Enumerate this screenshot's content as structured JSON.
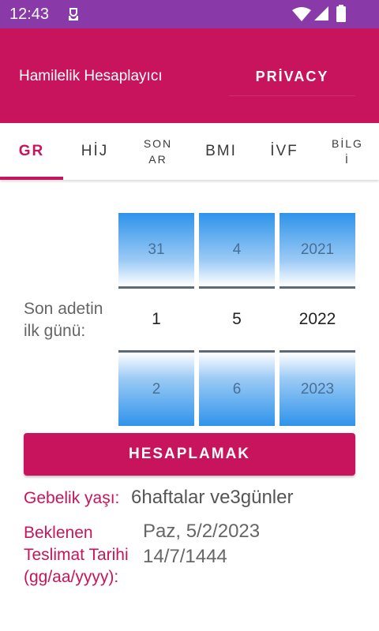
{
  "status_bar": {
    "time": "12:43"
  },
  "app_bar": {
    "title": "Hamilelik Hesaplayıcı",
    "privacy_label": "PRİVACY"
  },
  "tabs": [
    {
      "label": "GR",
      "active": true
    },
    {
      "label": "HİJ"
    },
    {
      "label_lines": [
        "SON",
        "AR"
      ]
    },
    {
      "label": "BMI"
    },
    {
      "label": "İVF"
    },
    {
      "label_lines": [
        "BİLG",
        "İ"
      ]
    }
  ],
  "form": {
    "lmp_label": "Son adetin ilk günü:",
    "pickers": {
      "day": {
        "prev": "31",
        "current": "1",
        "next": "2"
      },
      "month": {
        "prev": "4",
        "current": "5",
        "next": "6"
      },
      "year": {
        "prev": "2021",
        "current": "2022",
        "next": "2023"
      }
    },
    "calculate_label": "HESAPLAMAK"
  },
  "results": {
    "gestational_age_label": "Gebelik yaşı:",
    "gestational_age_value": "6haftalar ve3günler",
    "edd_label": "Beklenen Teslimat Tarihi (gg/aa/yyyy):",
    "edd_gregorian": "Paz, 5/2/2023",
    "edd_hijri": "14/7/1444"
  },
  "colors": {
    "status_bar": "#8a3aa8",
    "primary": "#c8145c",
    "picker_blue": "#2f93ea"
  },
  "icons": [
    "app-notification-icon",
    "wifi-icon",
    "signal-icon",
    "battery-icon"
  ]
}
